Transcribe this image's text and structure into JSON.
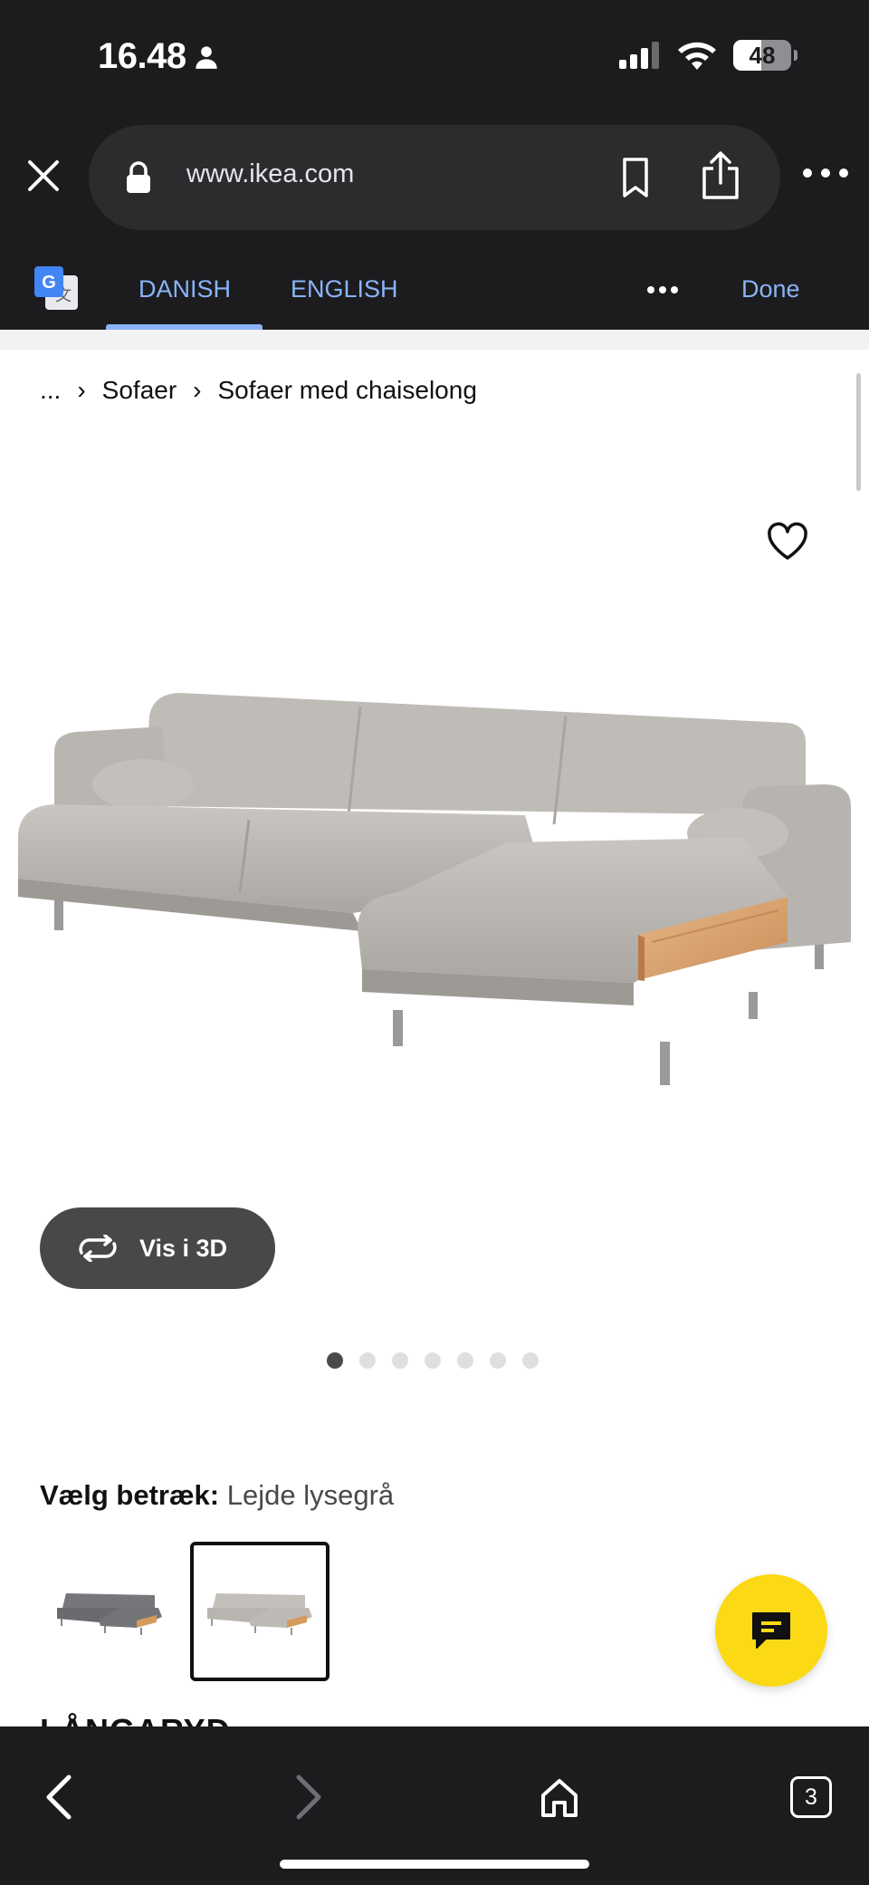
{
  "status_bar": {
    "time": "16.48",
    "battery": "48"
  },
  "browser": {
    "url": "www.ikea.com"
  },
  "translate": {
    "tab_source": "DANISH",
    "tab_target": "ENGLISH",
    "done": "Done"
  },
  "breadcrumb": {
    "ellipsis": "...",
    "items": [
      "Sofaer",
      "Sofaer med chaiselong"
    ]
  },
  "product": {
    "view_3d_label": "Vis i 3D",
    "image_count": 7,
    "active_image": 1,
    "choose_label": "Vælg betræk:",
    "choose_value": "Lejde lysegrå",
    "name_partial": "LÅNGARYD"
  },
  "tabs": {
    "count": "3"
  },
  "colors": {
    "accent": "#8ab4f8",
    "chat": "#fbd914",
    "chrome": "#1c1c1e",
    "button_dark": "#484848"
  },
  "icons": [
    "person-icon",
    "signal-icon",
    "wifi-icon",
    "close-icon",
    "lock-icon",
    "bookmark-icon",
    "share-icon",
    "more-icon",
    "google-translate-icon",
    "heart-icon",
    "rotate-icon",
    "chat-icon",
    "back-icon",
    "forward-icon",
    "home-icon",
    "tabs-icon"
  ]
}
